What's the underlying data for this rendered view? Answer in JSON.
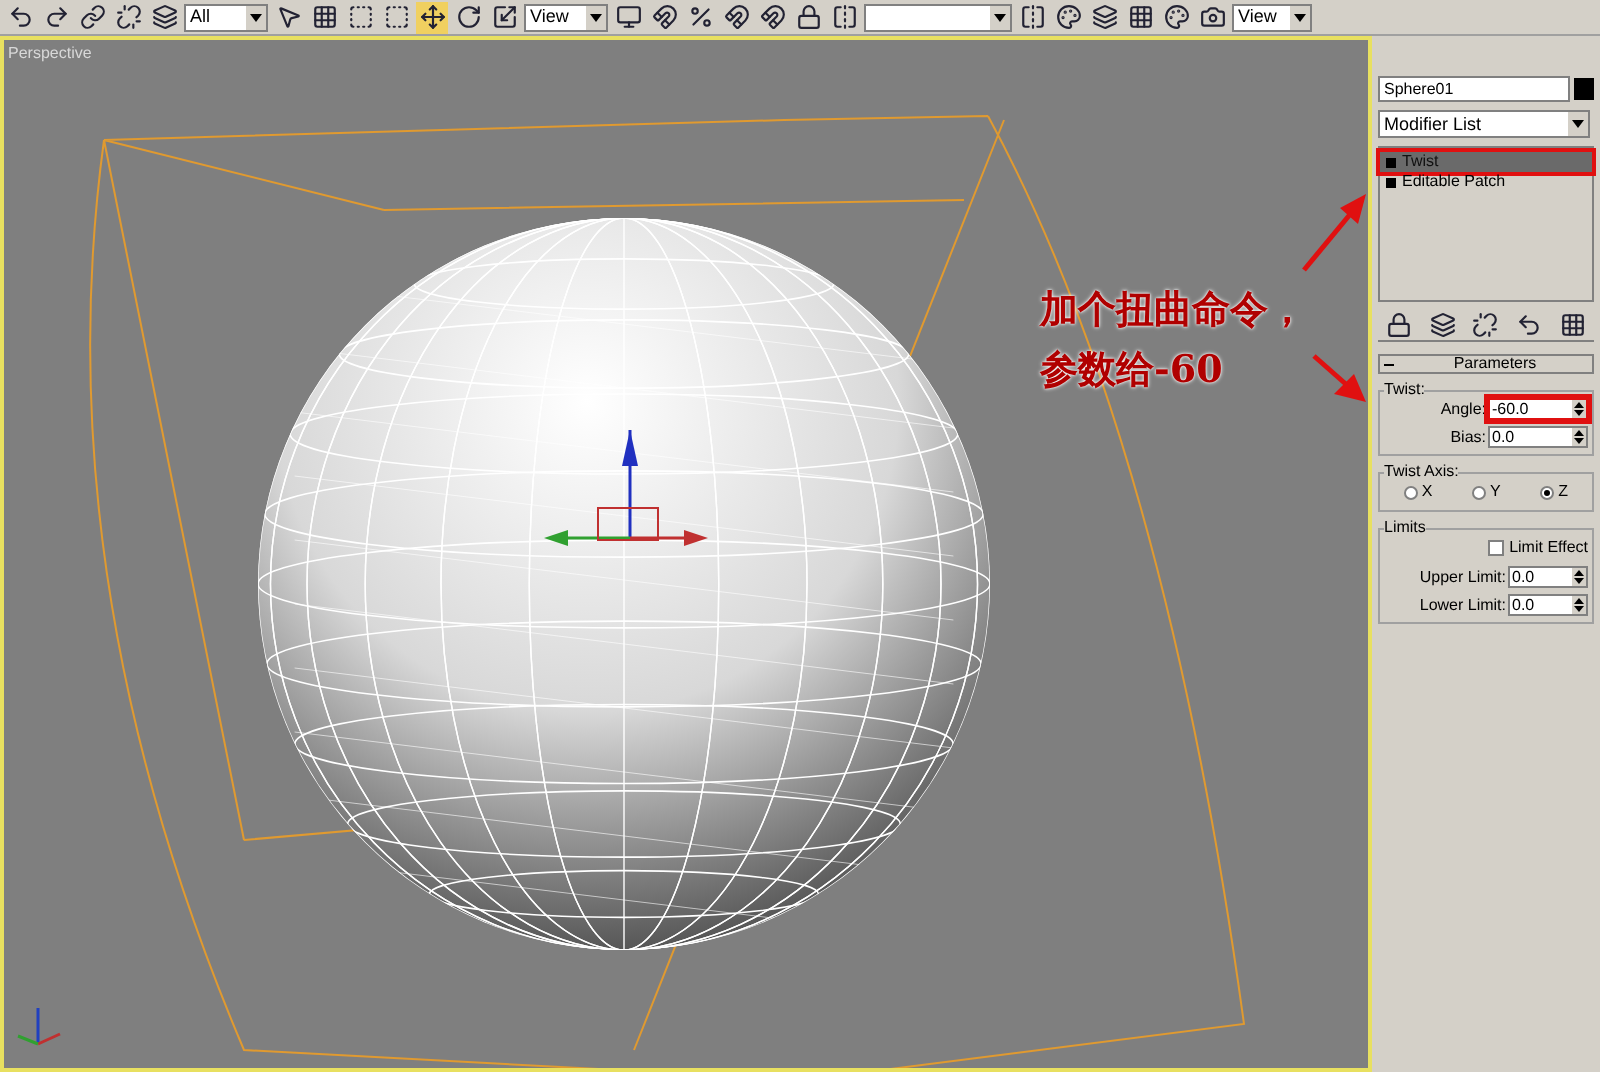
{
  "toolbar": {
    "selection_filter": "All",
    "reference_coord": "View",
    "view_dropdown": "View"
  },
  "viewport": {
    "label": "Perspective"
  },
  "annotation": {
    "lines": [
      "加个扭曲命令，",
      "参数给-60"
    ]
  },
  "command_panel": {
    "object_name": "Sphere01",
    "modifier_list": "Modifier List",
    "stack": [
      {
        "label": "Twist",
        "selected": true,
        "highlighted": true
      },
      {
        "label": "Editable Patch",
        "selected": false,
        "highlighted": false
      }
    ],
    "parameters": {
      "title": "Parameters",
      "twist_group": "Twist:",
      "angle": {
        "label": "Angle:",
        "value": "-60.0",
        "highlighted": true
      },
      "bias": {
        "label": "Bias:",
        "value": "0.0",
        "highlighted": false
      },
      "axis_group": "Twist Axis:",
      "axes": [
        {
          "label": "X",
          "selected": false
        },
        {
          "label": "Y",
          "selected": false
        },
        {
          "label": "Z",
          "selected": true
        }
      ],
      "limits_group": "Limits",
      "limit_effect": {
        "label": "Limit Effect",
        "checked": false
      },
      "upper": {
        "label": "Upper Limit:",
        "value": "0.0"
      },
      "lower": {
        "label": "Lower Limit:",
        "value": "0.0"
      }
    }
  }
}
